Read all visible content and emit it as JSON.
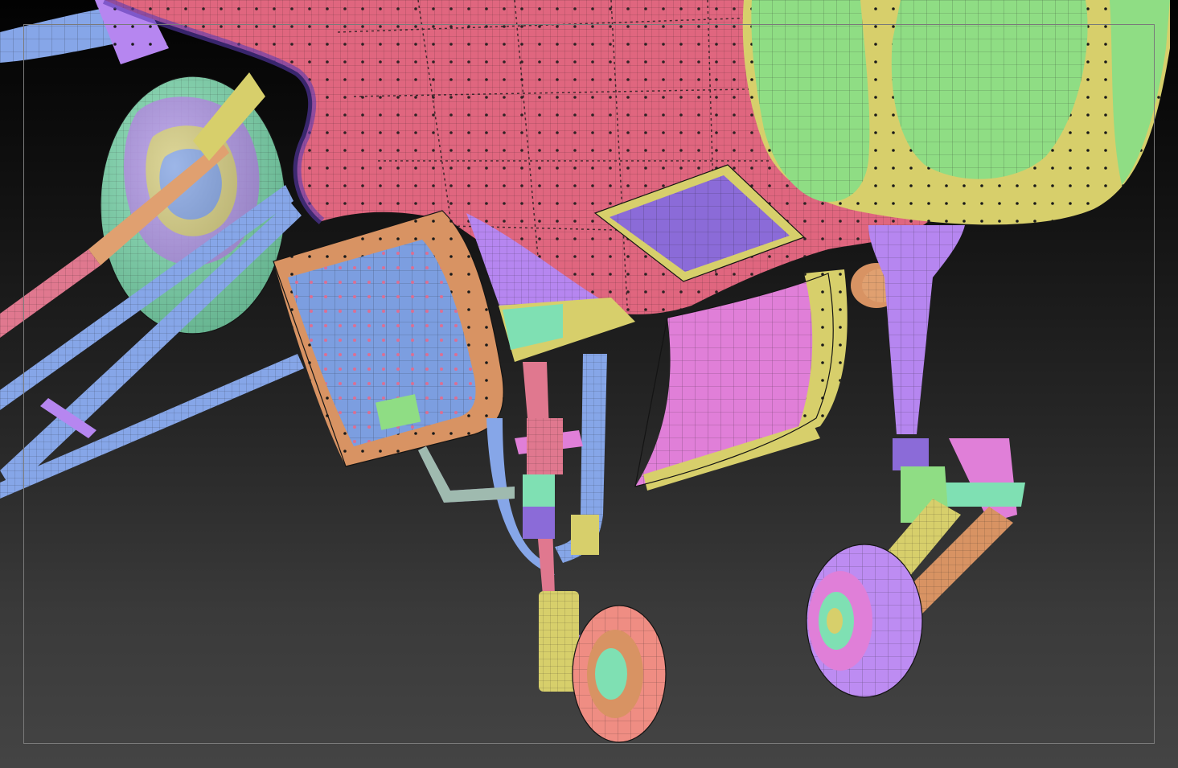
{
  "scene": {
    "view_mode": "polygroup-wireframe",
    "background": {
      "top": "#020202",
      "bottom": "#444444"
    },
    "palette": {
      "hull_pink": "#e0667f",
      "hull_pink_dark": "#c94f6a",
      "canopy_green": "#8fdd84",
      "trim_yellow": "#d7cf6b",
      "panel_blue": "#7c9ee0",
      "panel_purple": "#8b6bd8",
      "strut_blue": "#86a6e8",
      "strut_pink": "#e0788f",
      "trim_orange": "#d89363",
      "mint": "#7fe0b3",
      "violet": "#b686f0",
      "magenta": "#e07fd8",
      "wheel_salmon": "#ef8d83",
      "wheel_violet": "#bd8cf2",
      "tan": "#e0a070"
    }
  }
}
